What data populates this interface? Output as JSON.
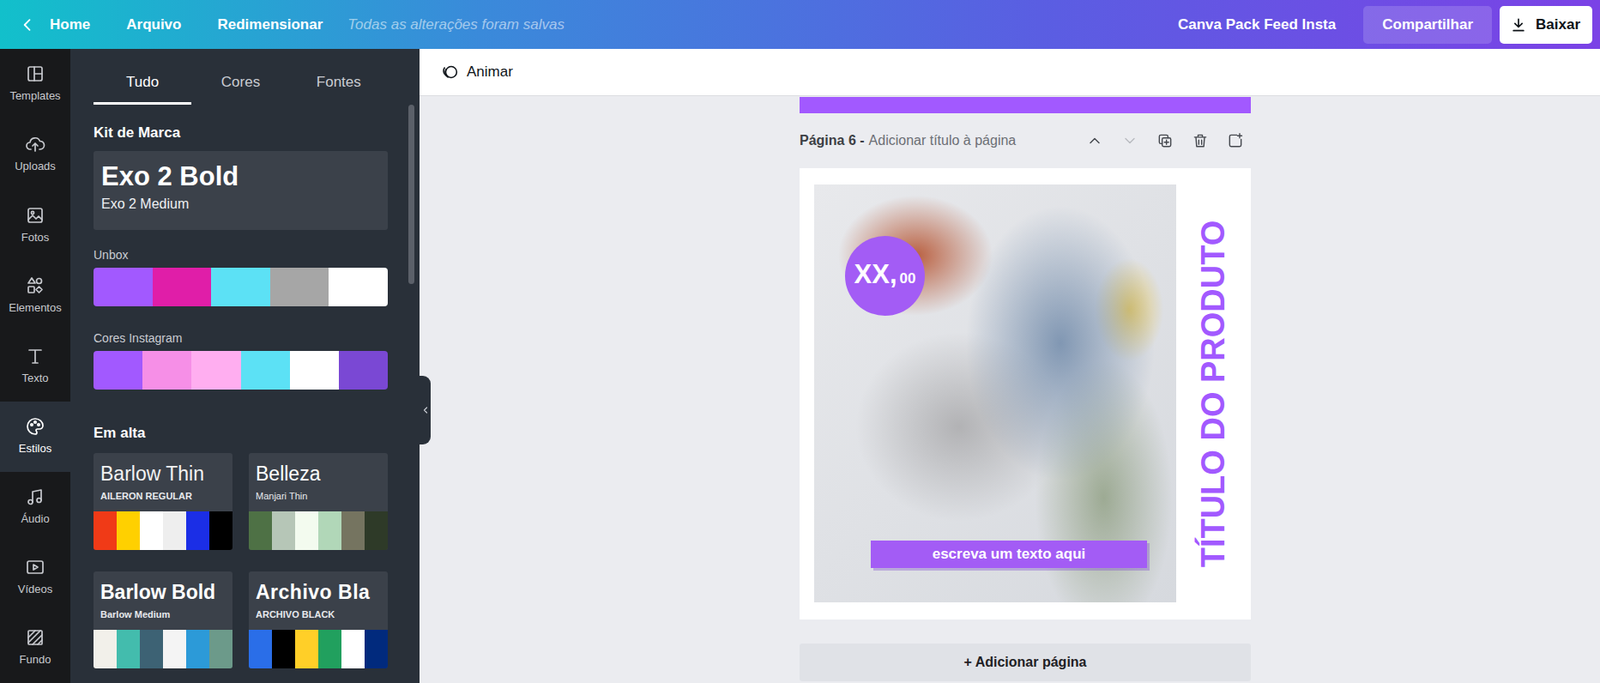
{
  "topbar": {
    "home": "Home",
    "menu": [
      "Arquivo",
      "Redimensionar"
    ],
    "status": "Todas as alterações foram salvas",
    "design_title": "Canva Pack Feed Insta",
    "share": "Compartilhar",
    "download": "Baixar"
  },
  "rail": [
    {
      "label": "Templates",
      "selected": false
    },
    {
      "label": "Uploads",
      "selected": false
    },
    {
      "label": "Fotos",
      "selected": false
    },
    {
      "label": "Elementos",
      "selected": false
    },
    {
      "label": "Texto",
      "selected": false
    },
    {
      "label": "Estilos",
      "selected": true
    },
    {
      "label": "Áudio",
      "selected": false
    },
    {
      "label": "Vídeos",
      "selected": false
    },
    {
      "label": "Fundo",
      "selected": false
    }
  ],
  "panel": {
    "tabs": [
      {
        "label": "Tudo",
        "selected": true
      },
      {
        "label": "Cores",
        "selected": false
      },
      {
        "label": "Fontes",
        "selected": false
      }
    ],
    "brand_kit": {
      "title": "Kit de Marca",
      "heading_font": "Exo 2 Bold",
      "body_font": "Exo 2 Medium",
      "palettes": [
        {
          "name": "Unbox",
          "swatches": [
            {
              "color": "#a259ff"
            },
            {
              "color": "#e01ea8"
            },
            {
              "color": "#5ce1f5"
            },
            {
              "color": "#a6a6a6"
            },
            {
              "color": "#ffffff"
            }
          ]
        },
        {
          "name": "Cores Instagram",
          "swatches": [
            {
              "color": "#a259ff"
            },
            {
              "color": "#f68fe7"
            },
            {
              "color": "#ffaef0"
            },
            {
              "color": "#5ce1f5"
            },
            {
              "color": "#ffffff"
            },
            {
              "color": "#7a48d4"
            }
          ]
        }
      ]
    },
    "trending": {
      "title": "Em alta",
      "styles": [
        {
          "heading": "Barlow Thin",
          "body": "AILERON REGULAR",
          "swatches": [
            {
              "color": "#f03a17"
            },
            {
              "color": "#ffd000"
            },
            {
              "color": "#ffffff"
            },
            {
              "color": "#eeeeee"
            },
            {
              "color": "#1b2ee6"
            },
            {
              "color": "#000000"
            }
          ]
        },
        {
          "heading": "Belleza",
          "body": "Manjari Thin",
          "swatches": [
            {
              "color": "#4e7145"
            },
            {
              "color": "#b6c6b7"
            },
            {
              "color": "#f3fbef"
            },
            {
              "color": "#b1d7b8"
            },
            {
              "color": "#757460"
            },
            {
              "color": "#2e3a28"
            }
          ]
        },
        {
          "heading": "Barlow Bold",
          "body": "Barlow Medium",
          "swatches": [
            {
              "color": "#f2f0ea"
            },
            {
              "color": "#43bcad"
            },
            {
              "color": "#3d6274"
            },
            {
              "color": "#f4f4f4"
            },
            {
              "color": "#2c9ad8"
            },
            {
              "color": "#6c9a8a"
            }
          ]
        },
        {
          "heading": "Archivo Bla",
          "body": "ARCHIVO BLACK",
          "swatches": [
            {
              "color": "#2a6ee8"
            },
            {
              "color": "#000000"
            },
            {
              "color": "#ffcf28"
            },
            {
              "color": "#21a05e"
            },
            {
              "color": "#ffffff"
            },
            {
              "color": "#012a7d"
            }
          ]
        }
      ]
    },
    "scrollbar": {
      "level": 0.31
    }
  },
  "toolbar": {
    "animate": "Animar"
  },
  "page": {
    "number_label": "Página 6 -",
    "title_placeholder": "Adicionar título à página",
    "controls": [
      {
        "disabled": false
      },
      {
        "disabled": true
      },
      {
        "disabled": false
      },
      {
        "disabled": false
      },
      {
        "disabled": false
      }
    ],
    "design": {
      "price": "XX,",
      "cents": "00",
      "caption": "escreva um texto aqui",
      "title": "TÍTULO DO PRODUTO"
    }
  },
  "add_page": "+ Adicionar página"
}
